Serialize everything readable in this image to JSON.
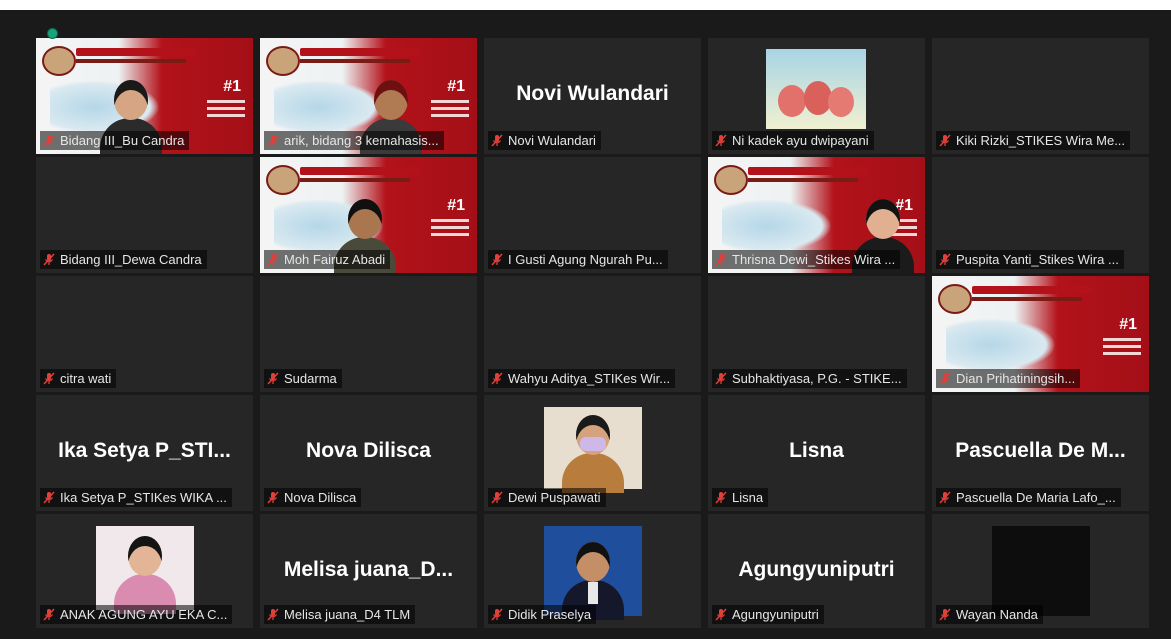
{
  "participants": [
    {
      "name": "Bidang III_Bu Candra",
      "display": "",
      "video": "banner-woman",
      "active": true
    },
    {
      "name": "arik, bidang 3 kemahasis...",
      "display": "",
      "video": "banner-man-cap"
    },
    {
      "name": "Novi Wulandari",
      "display": "Novi Wulandari",
      "video": "none"
    },
    {
      "name": "Ni kadek ayu dwipayani",
      "display": "",
      "video": "strawberry"
    },
    {
      "name": "Kiki Rizki_STIKES Wira Me...",
      "display": "",
      "video": "none"
    },
    {
      "name": "Bidang III_Dewa Candra",
      "display": "",
      "video": "none"
    },
    {
      "name": "Moh Fairuz Abadi",
      "display": "",
      "video": "banner-man-headset"
    },
    {
      "name": "I Gusti Agung Ngurah Pu...",
      "display": "",
      "video": "none"
    },
    {
      "name": "Thrisna Dewi_Stikes Wira ...",
      "display": "",
      "video": "banner-woman-right"
    },
    {
      "name": "Puspita Yanti_Stikes Wira ...",
      "display": "",
      "video": "none"
    },
    {
      "name": "citra wati",
      "display": "",
      "video": "none"
    },
    {
      "name": "Sudarma",
      "display": "",
      "video": "none"
    },
    {
      "name": "Wahyu Aditya_STIKes Wir...",
      "display": "",
      "video": "none"
    },
    {
      "name": "Subhaktiyasa, P.G. - STIKE...",
      "display": "",
      "video": "none"
    },
    {
      "name": "Dian Prihatiningsih...",
      "display": "",
      "video": "banner"
    },
    {
      "name": "Ika Setya P_STIKes WIKA ...",
      "display": "Ika Setya P_STI...",
      "video": "none"
    },
    {
      "name": "Nova Dilisca",
      "display": "Nova Dilisca",
      "video": "none"
    },
    {
      "name": "Dewi Puspawati",
      "display": "",
      "video": "photo-mask"
    },
    {
      "name": "Lisna",
      "display": "Lisna",
      "video": "none"
    },
    {
      "name": "Pascuella De Maria Lafo_...",
      "display": "Pascuella De M...",
      "video": "none"
    },
    {
      "name": "ANAK AGUNG AYU EKA C...",
      "display": "",
      "video": "photo-woman"
    },
    {
      "name": "Melisa juana_D4 TLM",
      "display": "Melisa juana_D...",
      "video": "none"
    },
    {
      "name": "Didik Praselya",
      "display": "",
      "video": "photo-suit"
    },
    {
      "name": "Agungyuniputri",
      "display": "Agungyuniputri",
      "video": "none"
    },
    {
      "name": "Wayan Nanda",
      "display": "",
      "video": "black"
    }
  ],
  "banner": {
    "number": "#1"
  },
  "colors": {
    "active_border": "#e8e36a",
    "muted_icon": "#e0403a",
    "tile_bg": "#262626"
  }
}
